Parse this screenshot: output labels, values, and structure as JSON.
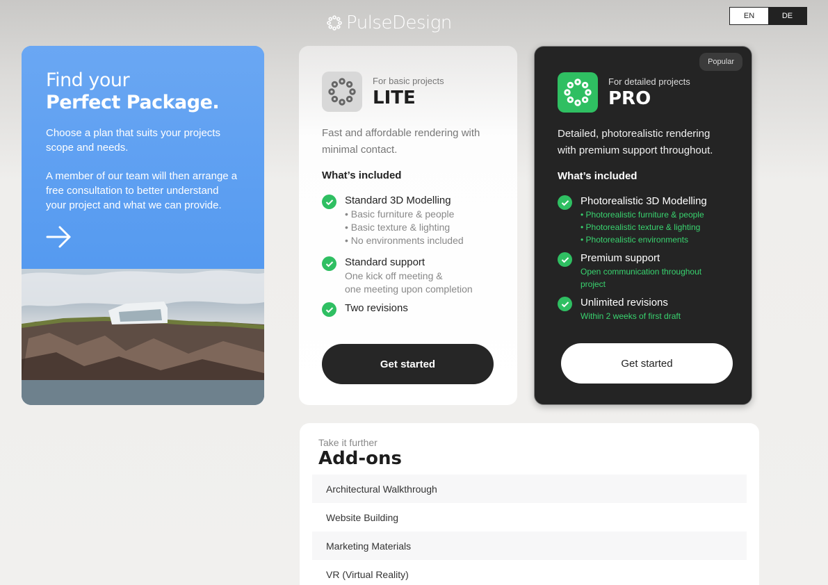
{
  "brand": {
    "name": "PulseDesign"
  },
  "lang": {
    "en": "EN",
    "de": "DE"
  },
  "intro": {
    "line1": "Find your",
    "line2": "Perfect Package.",
    "para1": "Choose a plan that suits your projects scope and needs.",
    "para2": "A member of our team will then arrange a free consultation to better understand your project and what we can provide."
  },
  "lite": {
    "sub": "For basic projects",
    "name": "LITE",
    "desc": "Fast and affordable rendering with minimal contact.",
    "included": "What’s included",
    "features": [
      {
        "title": "Standard 3D Modelling",
        "sub1": "• Basic furniture & people",
        "sub2": "• Basic texture & lighting",
        "sub3": "• No environments included"
      },
      {
        "title": "Standard support",
        "sub1": "One kick off meeting &",
        "sub2": "one meeting upon completion"
      },
      {
        "title": "Two revisions"
      }
    ],
    "button": "Get started"
  },
  "pro": {
    "badge": "Popular",
    "sub": "For detailed projects",
    "name": "PRO",
    "desc": "Detailed, photorealistic rendering with premium support throughout.",
    "included": "What’s included",
    "features": [
      {
        "title": "Photorealistic 3D Modelling",
        "sub1": "• Photorealistic furniture & people",
        "sub2": "• Photorealistic texture & lighting",
        "sub3": "• Photorealistic environments"
      },
      {
        "title": "Premium support",
        "sub1": "Open communication throughout project"
      },
      {
        "title": "Unlimited revisions",
        "sub1": "Within 2 weeks of first draft"
      }
    ],
    "button": "Get started"
  },
  "addons": {
    "sub": "Take it further",
    "title": "Add-ons",
    "items": [
      "Architectural Walkthrough",
      "Website Building",
      "Marketing Materials",
      "VR (Virtual Reality)"
    ]
  },
  "colors": {
    "accent_green": "#2fbf62",
    "intro_blue": "#5b9df0",
    "dark_card": "#242424"
  }
}
